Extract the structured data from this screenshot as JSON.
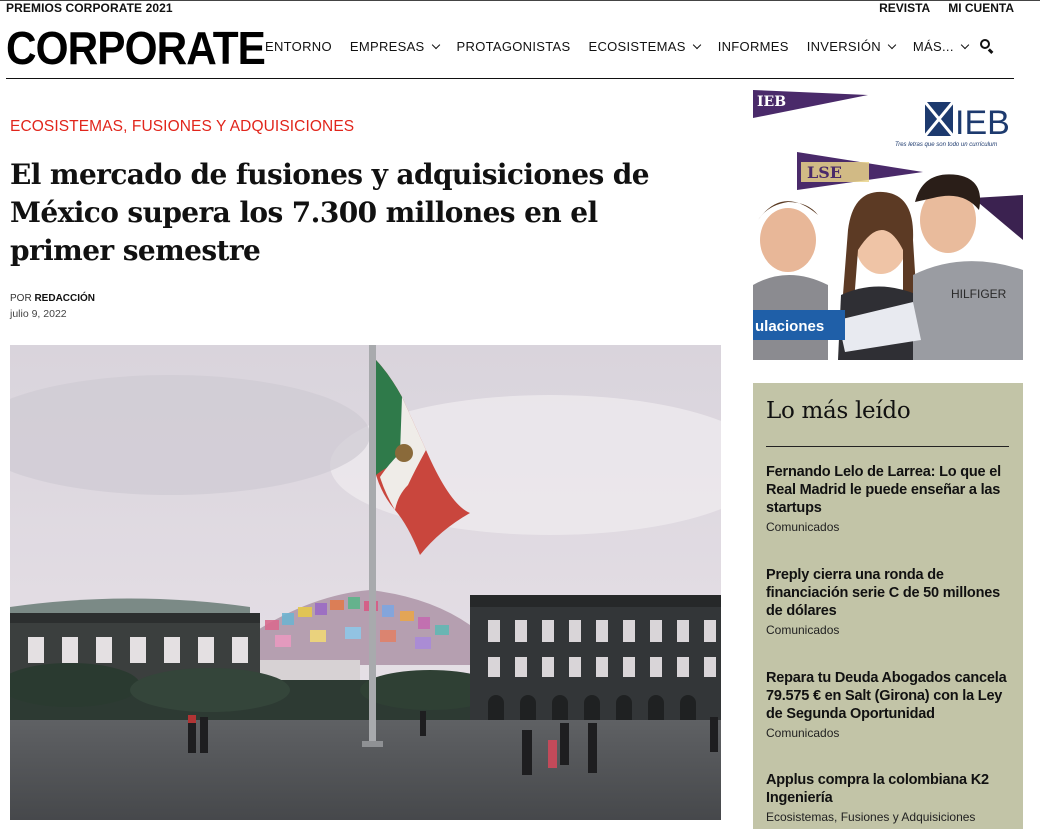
{
  "topbar": {
    "left": "PREMIOS CORPORATE 2021",
    "links": [
      "REVISTA",
      "MI CUENTA"
    ]
  },
  "header": {
    "logo": "CORPORATE",
    "nav": [
      {
        "label": "ENTORNO",
        "dropdown": false
      },
      {
        "label": "EMPRESAS",
        "dropdown": true
      },
      {
        "label": "PROTAGONISTAS",
        "dropdown": false
      },
      {
        "label": "ECOSISTEMAS",
        "dropdown": true
      },
      {
        "label": "INFORMES",
        "dropdown": false
      },
      {
        "label": "INVERSIÓN",
        "dropdown": true
      },
      {
        "label": "MÁS...",
        "dropdown": true
      }
    ],
    "search_icon": "search-icon"
  },
  "article": {
    "category": "ECOSISTEMAS, FUSIONES Y ADQUISICIONES",
    "title": "El mercado de fusiones y adquisiciones de México supera los 7.300 millones en el primer semestre",
    "by_prefix": "POR",
    "author": "REDACCIÓN",
    "date": "julio 9, 2022"
  },
  "ad": {
    "brand": "IEB",
    "tagline": "Tres letras que son todo un currículum",
    "pennant": "LSE",
    "banner_text": "ulaciones",
    "colors": {
      "navy": "#1d3a6e",
      "blue": "#1f5fa8",
      "purple": "#4a2a6a"
    }
  },
  "popular": {
    "heading": "Lo más leído",
    "items": [
      {
        "title": "Fernando Lelo de Larrea: Lo que el Real Madrid le puede enseñar a las startups",
        "category": "Comunicados"
      },
      {
        "title": "Preply cierra una ronda de financiación serie C de 50 millones de dólares",
        "category": "Comunicados"
      },
      {
        "title": "Repara tu Deuda Abogados cancela 79.575 € en Salt (Girona) con la Ley de Segunda Oportunidad",
        "category": "Comunicados"
      },
      {
        "title": "Applus compra la colombiana K2 Ingeniería",
        "category": "Ecosistemas, Fusiones y Adquisiciones"
      }
    ]
  },
  "colors": {
    "accent_red": "#e1251b",
    "sidebar_bg": "#c2c4a7"
  }
}
